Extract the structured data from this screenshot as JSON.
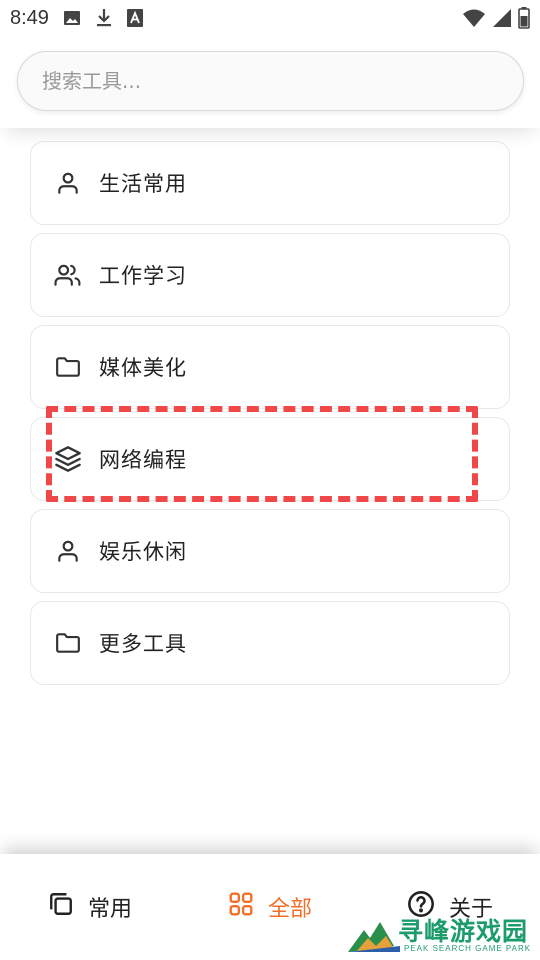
{
  "status_bar": {
    "time": "8:49",
    "icons_left": [
      "image-icon",
      "download-icon",
      "font-icon"
    ],
    "icons_right": [
      "wifi-icon",
      "signal-icon",
      "battery-icon"
    ]
  },
  "search": {
    "placeholder": "搜索工具..."
  },
  "categories": [
    {
      "label": "生活常用",
      "icon": "user-icon"
    },
    {
      "label": "工作学习",
      "icon": "users-icon"
    },
    {
      "label": "媒体美化",
      "icon": "folder-icon"
    },
    {
      "label": "网络编程",
      "icon": "layers-icon"
    },
    {
      "label": "娱乐休闲",
      "icon": "user-icon"
    },
    {
      "label": "更多工具",
      "icon": "folder-icon"
    }
  ],
  "bottom_nav": {
    "items": [
      {
        "label": "常用",
        "icon": "copy-icon",
        "active": false
      },
      {
        "label": "全部",
        "icon": "grid-icon",
        "active": true
      },
      {
        "label": "关于",
        "icon": "help-icon",
        "active": false
      }
    ],
    "accent_color": "#f26f2a"
  },
  "highlight_color": "#f04848",
  "watermark": {
    "title": "寻峰游戏园",
    "subtitle": "PEAK SEARCH GAME PARK"
  }
}
